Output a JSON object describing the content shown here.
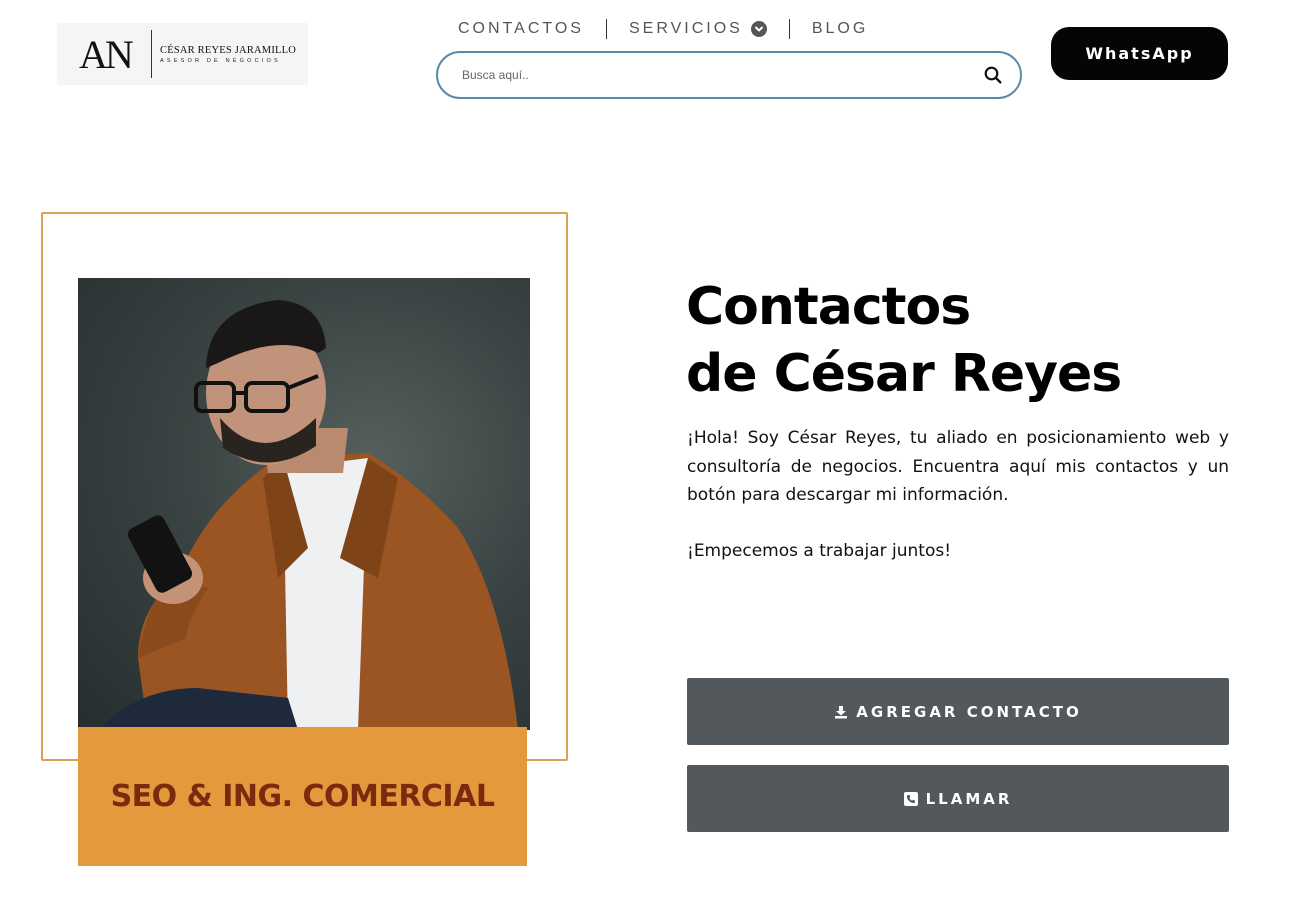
{
  "header": {
    "logo": {
      "mark": "AN",
      "name": "CÉSAR REYES JARAMILLO",
      "subtitle": "ASESOR DE NEGOCIOS"
    },
    "nav": [
      {
        "label": "CONTACTOS",
        "icon": null
      },
      {
        "label": "SERVICIOS",
        "icon": "chevron-down-icon"
      },
      {
        "label": "BLOG",
        "icon": null
      }
    ],
    "search": {
      "placeholder": "Busca aquí..",
      "value": "",
      "icon": "search-icon"
    },
    "whatsapp_label": "WhatsApp"
  },
  "hero": {
    "tagline": "SEO & ING. COMERCIAL",
    "title_line1": "Contactos",
    "title_line2": "de César Reyes",
    "intro": "¡Hola! Soy César Reyes, tu aliado en posicionamiento web y consultoría de negocios. Encuentra aquí mis contactos y un botón para descargar mi información.",
    "cta": "¡Empecemos a trabajar juntos!",
    "buttons": [
      {
        "label": "AGREGAR CONTACTO",
        "icon": "download-icon"
      },
      {
        "label": "LLAMAR",
        "icon": "phone-icon"
      }
    ]
  },
  "colors": {
    "frame_border": "#d9a05a",
    "tagline_bg": "#e3993c",
    "tagline_text": "#7a2a0e",
    "button_bg": "#53585d",
    "whatsapp_bg": "#050505",
    "search_border": "#5b8aa8"
  }
}
